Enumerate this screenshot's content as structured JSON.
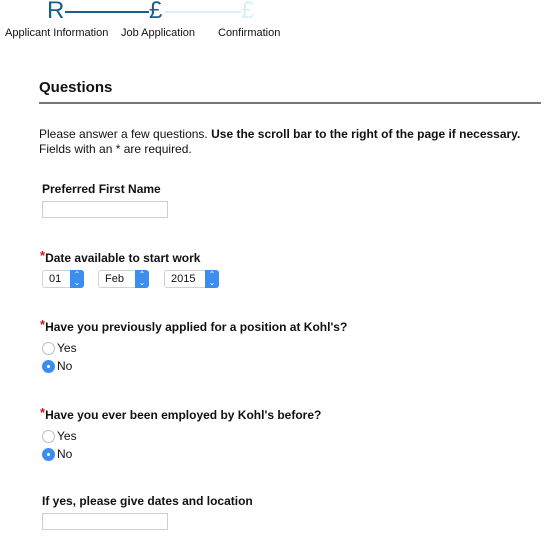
{
  "progress": {
    "steps": [
      {
        "glyph": "R",
        "label": "Applicant Information",
        "state": "done"
      },
      {
        "glyph": "£",
        "label": "Job Application",
        "state": "current"
      },
      {
        "glyph": "£",
        "label": "Confirmation",
        "state": "future"
      }
    ],
    "colors": {
      "active": "#1b5e8c",
      "future": "#d9eef8"
    }
  },
  "section": {
    "title": "Questions"
  },
  "intro": {
    "text_plain": "Please answer a few questions. ",
    "text_bold": "Use the scroll bar to the right of the page if necessary.",
    "text_line2": "Fields with an * are required."
  },
  "fields": {
    "preferred_name": {
      "label": "Preferred First Name",
      "value": ""
    },
    "start_date": {
      "label": "Date available to start work",
      "required_mark": "*",
      "day": "01",
      "month": "Feb",
      "year": "2015"
    },
    "previously_applied": {
      "label": "Have you previously applied for a position at Kohl's?",
      "required_mark": "*",
      "options": [
        "Yes",
        "No"
      ],
      "selected": "No"
    },
    "previously_employed": {
      "label": "Have you ever been employed by Kohl's before?",
      "required_mark": "*",
      "options": [
        "Yes",
        "No"
      ],
      "selected": "No"
    },
    "employment_details": {
      "label": "If yes, please give dates and location",
      "value": ""
    }
  },
  "colors": {
    "required": "#e0121a",
    "accent": "#3b8ef0"
  }
}
